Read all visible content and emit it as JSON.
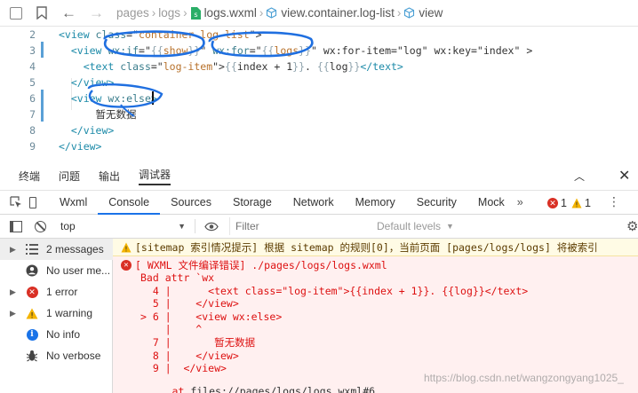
{
  "breadcrumb": {
    "items": [
      "pages",
      "logs",
      "logs.wxml",
      "view.container.log-list",
      "view"
    ]
  },
  "editor": {
    "lines": [
      {
        "num": "2",
        "parts": [
          [
            "tg",
            "<view "
          ],
          [
            "at",
            "class"
          ],
          [
            "tx",
            "=\""
          ],
          [
            "vl",
            "container log-list"
          ],
          [
            "tx",
            "\">"
          ]
        ]
      },
      {
        "num": "3",
        "parts": [
          [
            "tx",
            "  "
          ],
          [
            "tg",
            "<view "
          ],
          [
            "at",
            "wx:if"
          ],
          [
            "tx",
            "=\""
          ],
          [
            "mu",
            "{{"
          ],
          [
            "vl",
            "show"
          ],
          [
            "mu",
            "}}"
          ],
          [
            "tx",
            "\" "
          ],
          [
            "at",
            "wx:for"
          ],
          [
            "tx",
            "=\""
          ],
          [
            "mu",
            "{{"
          ],
          [
            "vl",
            "logs"
          ],
          [
            "mu",
            "}}"
          ],
          [
            "tx",
            "\" wx:for-item=\"log\" wx:key=\"index\" >"
          ]
        ]
      },
      {
        "num": "4",
        "parts": [
          [
            "tx",
            "    "
          ],
          [
            "tg",
            "<text "
          ],
          [
            "at",
            "class"
          ],
          [
            "tx",
            "=\""
          ],
          [
            "vl",
            "log-item"
          ],
          [
            "tx",
            "\">"
          ],
          [
            "mu",
            "{{"
          ],
          [
            "tx",
            "index + 1"
          ],
          [
            "mu",
            "}}"
          ],
          [
            "tx",
            ". "
          ],
          [
            "mu",
            "{{"
          ],
          [
            "tx",
            "log"
          ],
          [
            "mu",
            "}}"
          ],
          [
            "tg",
            "</text>"
          ]
        ]
      },
      {
        "num": "5",
        "parts": [
          [
            "tx",
            "  "
          ],
          [
            "tg",
            "</view>"
          ]
        ]
      },
      {
        "num": "6",
        "parts": [
          [
            "tx",
            "  "
          ],
          [
            "tg",
            "<view "
          ],
          [
            "at",
            "wx:else"
          ],
          [
            "tg",
            ">"
          ]
        ]
      },
      {
        "num": "7",
        "parts": [
          [
            "tx",
            "      暂无数据"
          ]
        ]
      },
      {
        "num": "8",
        "parts": [
          [
            "tx",
            "  "
          ],
          [
            "tg",
            "</view>"
          ]
        ]
      },
      {
        "num": "9",
        "parts": [
          [
            "tg",
            "</view>"
          ]
        ]
      }
    ]
  },
  "devtools_tabs": [
    "终端",
    "问题",
    "输出",
    "调试器"
  ],
  "panel_tabs": [
    "Wxml",
    "Console",
    "Sources",
    "Storage",
    "Network",
    "Memory",
    "Security",
    "Mock"
  ],
  "badges": {
    "errors": "1",
    "warnings": "1"
  },
  "console_toolbar": {
    "context": "top",
    "filter_placeholder": "Filter",
    "levels": "Default levels"
  },
  "sidebar": [
    {
      "label": "2 messages",
      "icon": "list-icon",
      "arrow": true
    },
    {
      "label": "No user me...",
      "icon": "user-icon",
      "arrow": false
    },
    {
      "label": "1 error",
      "icon": "error-icon",
      "arrow": true
    },
    {
      "label": "1 warning",
      "icon": "warning-icon",
      "arrow": true
    },
    {
      "label": "No info",
      "icon": "info-icon",
      "arrow": false
    },
    {
      "label": "No verbose",
      "icon": "bug-icon",
      "arrow": false
    }
  ],
  "console": {
    "warning": "[sitemap 索引情况提示] 根据 sitemap 的规则[0]，当前页面 [pages/logs/logs] 将被索引",
    "error_header": "[ WXML 文件编译错误] ./pages/logs/logs.wxml",
    "error_lines": [
      "Bad attr `wx",
      "  4 |      <text class=\"log-item\">{{index + 1}}. {{log}}</text>",
      "  5 |    </view>",
      "> 6 |    <view wx:else>",
      "    |    ^",
      "  7 |       暂无数据",
      "  8 |    </view>",
      "  9 |  </view>"
    ],
    "at_prefix": "at ",
    "at_link": "files://pages/logs/logs.wxml#6"
  },
  "watermark": "https://blog.csdn.net/wangzongyang1025_"
}
